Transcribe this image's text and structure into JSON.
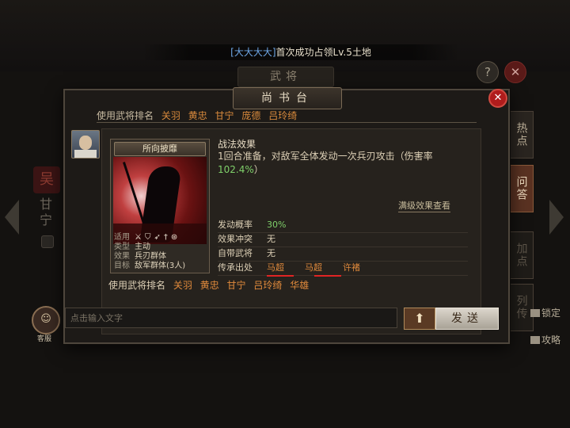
{
  "ticker": {
    "name": "[大大大大]",
    "text": "首次成功占领Lv.5土地"
  },
  "background": {
    "tab_label": "武将",
    "help_label": "?",
    "close_label": "✕",
    "faction": "吴",
    "hero_name": "甘宁",
    "customer_service": "客服",
    "side_tabs": [
      "热点",
      "问答",
      "加点",
      "列传"
    ],
    "right_options": [
      "锁定",
      "攻略"
    ]
  },
  "modal": {
    "title": "尚书台",
    "close_label": "✕",
    "ghost_row": {
      "label": "使用武将排名",
      "generals": [
        "关羽",
        "黄忠",
        "甘宁",
        "庞德",
        "吕玲绮"
      ]
    },
    "tactic_card": {
      "name": "所向披靡",
      "info": [
        {
          "key": "适用",
          "value": ""
        },
        {
          "key": "类型",
          "value": "主动"
        },
        {
          "key": "效果",
          "value": "兵刃群体"
        },
        {
          "key": "目标",
          "value": "敌军群体(3人)"
        }
      ],
      "unit_icons": [
        "spear-icon",
        "shield-icon",
        "bow-icon",
        "sword-icon",
        "catapult-icon"
      ]
    },
    "effect": {
      "title": "战法效果",
      "desc_prefix": "1回合准备，对敌军全体发动一次兵刃攻击（伤害率",
      "desc_value": "102.4%",
      "desc_suffix": "）",
      "full_link": "满级效果查看"
    },
    "stats": [
      {
        "key": "发动概率",
        "value": "30%"
      },
      {
        "key": "效果冲突",
        "value": "无"
      },
      {
        "key": "自带武将",
        "value": "无"
      },
      {
        "key": "传承出处",
        "values": [
          "马超",
          "马超",
          "许褚"
        ]
      }
    ],
    "ranking": {
      "label": "使用武将排名",
      "generals": [
        "关羽",
        "黄忠",
        "甘宁",
        "吕玲绮",
        "华雄"
      ]
    }
  },
  "chat": {
    "placeholder": "点击输入文字",
    "up_label": "⬆",
    "send_label": "发送"
  }
}
